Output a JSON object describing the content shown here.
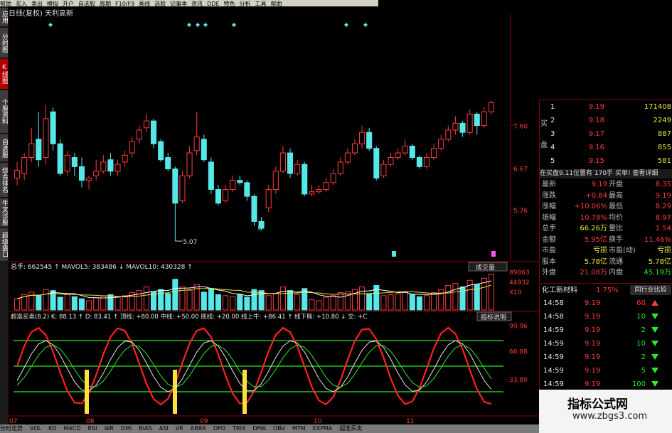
{
  "menu": {
    "items": [
      "帮助",
      "买入",
      "卖出",
      "模拟",
      "开户",
      "自选股",
      "周期",
      "F10/F9",
      "画线",
      "选股",
      "记事本",
      "资讯",
      "DDE",
      "特色",
      "分析",
      "工具",
      "帮助"
    ]
  },
  "left_tabs": [
    {
      "label": "应用",
      "active": false
    },
    {
      "label": "分时图",
      "active": false
    },
    {
      "label": "K线图",
      "active": true
    },
    {
      "label": "个股资料",
      "active": false
    },
    {
      "label": "自选股",
      "active": false
    },
    {
      "label": "综合排名",
      "active": false
    },
    {
      "label": "牛叉诊股",
      "active": false
    },
    {
      "label": "超级盘口",
      "active": false
    }
  ],
  "chart": {
    "title": "日线(复权) 天利高新",
    "price_ticks": [
      "7.60",
      "6.67",
      "5.76"
    ],
    "low_label": "5.07",
    "marker_label": "U",
    "volume_header": "总手: 662545 ↑  MAVOL5: 383486 ↓  MAVOL10: 430328 ↑",
    "volume_btn": "成交量",
    "volume_ticks": [
      "89863",
      "44932",
      "X10"
    ],
    "indicator_header": "超准买卖(8.2)  K: 88.13 ↑  D: 83.41 ↑  顶线: +80.00  中线: +50.00  底线: +20.00  线上牛: +86.41 ↑  线下熊: +10.80 ↓  交: +C",
    "indicator_btn": "指标说明",
    "indicator_ticks": [
      "99.96",
      "66.88",
      "33.80"
    ],
    "date_ticks": [
      "07",
      "08",
      "09",
      "10",
      "11"
    ],
    "candles": [
      {
        "o": 6.45,
        "c": 6.62,
        "h": 6.8,
        "l": 6.3
      },
      {
        "o": 6.55,
        "c": 6.9,
        "h": 7.0,
        "l": 6.4
      },
      {
        "o": 6.9,
        "c": 7.2,
        "h": 7.55,
        "l": 6.8
      },
      {
        "o": 7.3,
        "c": 6.85,
        "h": 7.9,
        "l": 6.7
      },
      {
        "o": 6.9,
        "c": 7.75,
        "h": 8.05,
        "l": 6.75
      },
      {
        "o": 7.9,
        "c": 7.2,
        "h": 8.0,
        "l": 7.05
      },
      {
        "o": 7.2,
        "c": 6.55,
        "h": 7.3,
        "l": 6.5
      },
      {
        "o": 6.6,
        "c": 6.95,
        "h": 7.05,
        "l": 6.5
      },
      {
        "o": 6.9,
        "c": 6.7,
        "h": 7.0,
        "l": 6.5
      },
      {
        "o": 6.7,
        "c": 6.4,
        "h": 6.9,
        "l": 6.25
      },
      {
        "o": 6.4,
        "c": 6.45,
        "h": 6.5,
        "l": 6.2
      },
      {
        "o": 6.5,
        "c": 6.6,
        "h": 6.85,
        "l": 6.4
      },
      {
        "o": 6.6,
        "c": 6.8,
        "h": 6.95,
        "l": 6.55
      },
      {
        "o": 6.85,
        "c": 6.6,
        "h": 7.0,
        "l": 6.5
      },
      {
        "o": 6.6,
        "c": 6.75,
        "h": 6.85,
        "l": 6.5
      },
      {
        "o": 6.8,
        "c": 6.95,
        "h": 7.05,
        "l": 6.7
      },
      {
        "o": 7.0,
        "c": 7.25,
        "h": 7.35,
        "l": 6.9
      },
      {
        "o": 7.3,
        "c": 7.5,
        "h": 7.6,
        "l": 7.2
      },
      {
        "o": 7.55,
        "c": 7.7,
        "h": 7.85,
        "l": 7.45
      },
      {
        "o": 7.7,
        "c": 7.2,
        "h": 7.75,
        "l": 7.1
      },
      {
        "o": 7.25,
        "c": 6.85,
        "h": 7.3,
        "l": 6.8
      },
      {
        "o": 6.9,
        "c": 6.65,
        "h": 7.0,
        "l": 6.6
      },
      {
        "o": 6.65,
        "c": 5.9,
        "h": 6.7,
        "l": 5.07
      },
      {
        "o": 5.95,
        "c": 6.5,
        "h": 6.6,
        "l": 5.9
      },
      {
        "o": 6.5,
        "c": 7.0,
        "h": 7.15,
        "l": 6.45
      },
      {
        "o": 7.05,
        "c": 7.35,
        "h": 7.9,
        "l": 6.95
      },
      {
        "o": 7.3,
        "c": 6.85,
        "h": 7.4,
        "l": 6.8
      },
      {
        "o": 6.8,
        "c": 6.2,
        "h": 6.9,
        "l": 6.1
      },
      {
        "o": 6.2,
        "c": 5.9,
        "h": 6.3,
        "l": 5.85
      },
      {
        "o": 5.95,
        "c": 6.2,
        "h": 6.3,
        "l": 5.9
      },
      {
        "o": 6.2,
        "c": 6.4,
        "h": 6.5,
        "l": 6.15
      },
      {
        "o": 6.4,
        "c": 6.35,
        "h": 6.5,
        "l": 6.3
      },
      {
        "o": 6.35,
        "c": 6.05,
        "h": 6.4,
        "l": 5.95
      },
      {
        "o": 6.05,
        "c": 5.5,
        "h": 6.1,
        "l": 5.4
      },
      {
        "o": 5.5,
        "c": 5.35,
        "h": 5.6,
        "l": 5.3
      },
      {
        "o": 5.8,
        "c": 6.2,
        "h": 6.3,
        "l": 5.7
      },
      {
        "o": 6.2,
        "c": 6.6,
        "h": 6.7,
        "l": 6.1
      },
      {
        "o": 6.6,
        "c": 7.0,
        "h": 7.15,
        "l": 6.55
      },
      {
        "o": 7.0,
        "c": 6.55,
        "h": 7.1,
        "l": 6.45
      },
      {
        "o": 6.55,
        "c": 6.75,
        "h": 6.85,
        "l": 6.5
      },
      {
        "o": 6.75,
        "c": 6.1,
        "h": 6.8,
        "l": 6.05
      },
      {
        "o": 6.1,
        "c": 6.15,
        "h": 6.3,
        "l": 6.05
      },
      {
        "o": 6.15,
        "c": 6.2,
        "h": 6.3,
        "l": 6.1
      },
      {
        "o": 6.2,
        "c": 6.35,
        "h": 6.45,
        "l": 6.15
      },
      {
        "o": 6.35,
        "c": 6.55,
        "h": 6.65,
        "l": 6.3
      },
      {
        "o": 6.55,
        "c": 6.8,
        "h": 6.9,
        "l": 6.5
      },
      {
        "o": 6.8,
        "c": 7.0,
        "h": 7.1,
        "l": 6.75
      },
      {
        "o": 7.0,
        "c": 7.2,
        "h": 7.3,
        "l": 6.95
      },
      {
        "o": 7.2,
        "c": 7.45,
        "h": 7.6,
        "l": 7.1
      },
      {
        "o": 7.45,
        "c": 7.1,
        "h": 7.55,
        "l": 7.05
      },
      {
        "o": 7.1,
        "c": 6.45,
        "h": 7.15,
        "l": 6.4
      },
      {
        "o": 6.5,
        "c": 6.75,
        "h": 6.85,
        "l": 6.45
      },
      {
        "o": 6.75,
        "c": 6.9,
        "h": 7.0,
        "l": 6.7
      },
      {
        "o": 6.9,
        "c": 7.0,
        "h": 7.1,
        "l": 6.85
      },
      {
        "o": 7.0,
        "c": 7.15,
        "h": 7.3,
        "l": 6.95
      },
      {
        "o": 7.15,
        "c": 6.9,
        "h": 7.2,
        "l": 6.85
      },
      {
        "o": 6.9,
        "c": 6.7,
        "h": 6.95,
        "l": 6.65
      },
      {
        "o": 6.7,
        "c": 6.9,
        "h": 7.0,
        "l": 6.65
      },
      {
        "o": 6.9,
        "c": 7.1,
        "h": 7.2,
        "l": 6.85
      },
      {
        "o": 7.1,
        "c": 7.3,
        "h": 7.4,
        "l": 7.05
      },
      {
        "o": 7.3,
        "c": 7.5,
        "h": 7.6,
        "l": 7.25
      },
      {
        "o": 7.5,
        "c": 7.65,
        "h": 7.8,
        "l": 7.4
      },
      {
        "o": 7.65,
        "c": 7.45,
        "h": 7.7,
        "l": 7.35
      },
      {
        "o": 7.45,
        "c": 7.85,
        "h": 7.95,
        "l": 7.4
      },
      {
        "o": 7.85,
        "c": 7.6,
        "h": 7.9,
        "l": 7.4
      },
      {
        "o": 7.6,
        "c": 7.9,
        "h": 8.0,
        "l": 7.55
      },
      {
        "o": 7.9,
        "c": 8.1,
        "h": 8.15,
        "l": 7.85
      }
    ],
    "volumes": [
      22,
      30,
      35,
      28,
      40,
      38,
      25,
      30,
      26,
      22,
      18,
      24,
      27,
      30,
      26,
      28,
      34,
      38,
      45,
      36,
      40,
      32,
      60,
      45,
      38,
      50,
      35,
      42,
      30,
      28,
      26,
      30,
      25,
      40,
      38,
      28,
      32,
      45,
      38,
      30,
      42,
      20,
      18,
      25,
      28,
      34,
      36,
      40,
      45,
      32,
      48,
      28,
      30,
      32,
      35,
      30,
      26,
      28,
      34,
      40,
      48,
      52,
      45,
      58,
      50,
      62,
      70
    ]
  },
  "right_panel": {
    "buy_label": "买 盘",
    "order_book": [
      {
        "level": "1",
        "price": "9.19",
        "vol": "171408"
      },
      {
        "level": "2",
        "price": "9.18",
        "vol": "2249"
      },
      {
        "level": "3",
        "price": "9.17",
        "vol": "887"
      },
      {
        "level": "4",
        "price": "9.16",
        "vol": "855"
      },
      {
        "level": "5",
        "price": "9.15",
        "vol": "581"
      }
    ],
    "position_line": "在买盘9.11位置有  170手  买单! 查看详细",
    "quote_rows": [
      {
        "l1": "最新",
        "v1": "9.19",
        "l2": "开盘",
        "v2": "8.35"
      },
      {
        "l1": "涨跌",
        "v1": "+0.84",
        "l2": "最高",
        "v2": "9.19"
      },
      {
        "l1": "涨幅",
        "v1": "+10.06%",
        "l2": "最低",
        "v2": "8.29"
      },
      {
        "l1": "振幅",
        "v1": "10.78%",
        "l2": "均价",
        "v2": "8.97"
      },
      {
        "l1": "总手",
        "v1": "66.26万",
        "l2": "量比",
        "v2": "1.54"
      },
      {
        "l1": "金额",
        "v1": "5.95亿",
        "l2": "换手",
        "v2": "11.46%"
      },
      {
        "l1": "市盈",
        "v1": "亏损",
        "l2": "市盈(动)",
        "v2": "亏损"
      },
      {
        "l1": "股本",
        "v1": "5.78亿",
        "l2": "流通",
        "v2": "5.78亿"
      },
      {
        "l1": "外盘",
        "v1": "21.08万",
        "l2": "内盘",
        "v2": "45.19万"
      }
    ],
    "industry": {
      "name": "化工新材料",
      "change": "1.75%",
      "button": "同行业比较"
    },
    "trades": [
      {
        "time": "14:58",
        "price": "9.19",
        "vol": "60",
        "dir": "up"
      },
      {
        "time": "14:58",
        "price": "9.19",
        "vol": "10",
        "dir": "down"
      },
      {
        "time": "14:59",
        "price": "9.19",
        "vol": "2",
        "dir": "down"
      },
      {
        "time": "14:59",
        "price": "9.19",
        "vol": "10",
        "dir": "down"
      },
      {
        "time": "14:59",
        "price": "9.19",
        "vol": "2",
        "dir": "down"
      },
      {
        "time": "14:59",
        "price": "9.19",
        "vol": "5",
        "dir": "down"
      },
      {
        "time": "14:59",
        "price": "9.19",
        "vol": "100",
        "dir": "down"
      }
    ]
  },
  "watermark": {
    "title": "指标公式网",
    "url": "www.zbgs3.com"
  },
  "bottom_tabs": [
    "分时走势",
    "VOL",
    "KD",
    "MACD",
    "RSI",
    "WR",
    "DMI",
    "BIAS",
    "ASI",
    "VR",
    "ARBR",
    "DPO",
    "TRIX",
    "DMA",
    "OBV",
    "MTM",
    "EXPMA",
    "超准买卖"
  ],
  "colors": {
    "up": "#ff3c3c",
    "down": "#56e8e8",
    "bg": "#000000",
    "grid": "#8b0000"
  }
}
